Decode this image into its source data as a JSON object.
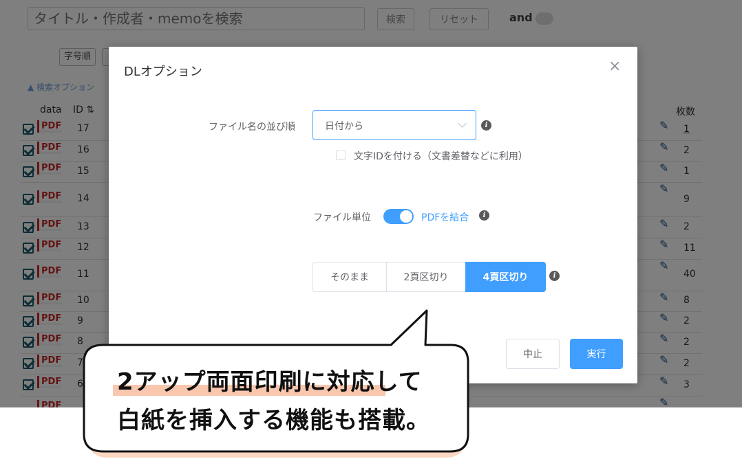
{
  "search": {
    "placeholder": "タイトル・作成者・memoを検索"
  },
  "toolbar": {
    "search_label": "検索",
    "reset_label": "リセット",
    "andor_label": "and"
  },
  "chips": [
    "字号順"
  ],
  "options_toggle": "▲ 検索オプション",
  "table": {
    "headers": {
      "data": "data",
      "id": "ID ⇅",
      "count": "枚数"
    },
    "pdf_label": "PDF",
    "rows": [
      {
        "id": "17",
        "count": "1"
      },
      {
        "id": "16",
        "count": "2"
      },
      {
        "id": "15",
        "count": "1"
      },
      {
        "id": "14",
        "count": "9"
      },
      {
        "id": "13",
        "count": "2"
      },
      {
        "id": "12",
        "count": "11"
      },
      {
        "id": "11",
        "count": "40"
      },
      {
        "id": "10",
        "count": "8"
      },
      {
        "id": "9",
        "count": "2"
      },
      {
        "id": "8",
        "count": "2"
      },
      {
        "id": "7",
        "count": "2"
      },
      {
        "id": "6",
        "count": "3"
      }
    ]
  },
  "dialog": {
    "title": "DLオプション",
    "close_icon": "×",
    "sort_label": "ファイル名の並び順",
    "sort_value": "日付から",
    "charid_label": "文字IDを付ける（文書差替などに利用）",
    "unit_label": "ファイル単位",
    "unit_active_label": "PDFを結合",
    "segments": [
      "そのまま",
      "2頁区切り",
      "4頁区切り"
    ],
    "selected_segment": "4頁区切り",
    "cancel_label": "中止",
    "run_label": "実行"
  },
  "callout": {
    "line1": "2アップ両面印刷に対応して",
    "line2": "白紙を挿入する機能も搭載。"
  },
  "colors": {
    "primary": "#409eff",
    "pdf_red": "#c62828",
    "callout_accent": "#fbd7c2"
  }
}
